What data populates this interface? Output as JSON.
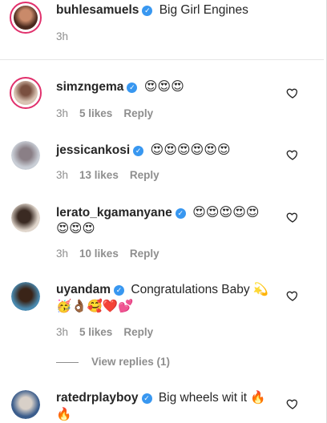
{
  "comments": [
    {
      "username": "buhlesamuels",
      "text": "Big Girl Engines",
      "time": "3h",
      "avatar_colors": [
        "#4a2a1e",
        "#c98a6a"
      ]
    },
    {
      "username": "simzngema",
      "text": "😍😍😍",
      "time": "3h",
      "likes": "5 likes",
      "reply": "Reply",
      "avatar_colors": [
        "#d9c4b4",
        "#7a5040"
      ]
    },
    {
      "username": "jessicankosi",
      "text": "😍😍😍😍😍😍",
      "time": "3h",
      "likes": "13 likes",
      "reply": "Reply",
      "avatar_colors": [
        "#c9ced6",
        "#8a7f86"
      ]
    },
    {
      "username": "lerato_kgamanyane",
      "text_line1": "😍😍😍😍😍",
      "text_line2": "😍😍😍",
      "time": "3h",
      "likes": "10 likes",
      "reply": "Reply",
      "avatar_colors": [
        "#e0d6cc",
        "#3a2a22"
      ]
    },
    {
      "username": "uyandam",
      "text_line1": "Congratulations Baby 💫",
      "text_line2": "🥳👌🏾🥰❤️💕",
      "time": "3h",
      "likes": "5 likes",
      "reply": "Reply",
      "avatar_colors": [
        "#4a8ab0",
        "#3a2418"
      ]
    },
    {
      "username": "ratedrplayboy",
      "text_line1": "Big wheels wit it 🔥",
      "text_line2": "🔥",
      "avatar_colors": [
        "#3b5d8c",
        "#d8d0c8"
      ]
    }
  ],
  "view_replies": "View replies (1)",
  "icons": {
    "like": "heart-outline-icon",
    "verified": "verified-badge-icon"
  },
  "colors": {
    "verified": "#3897f0",
    "ring": "#e1306c",
    "meta": "#8e8e8e"
  }
}
